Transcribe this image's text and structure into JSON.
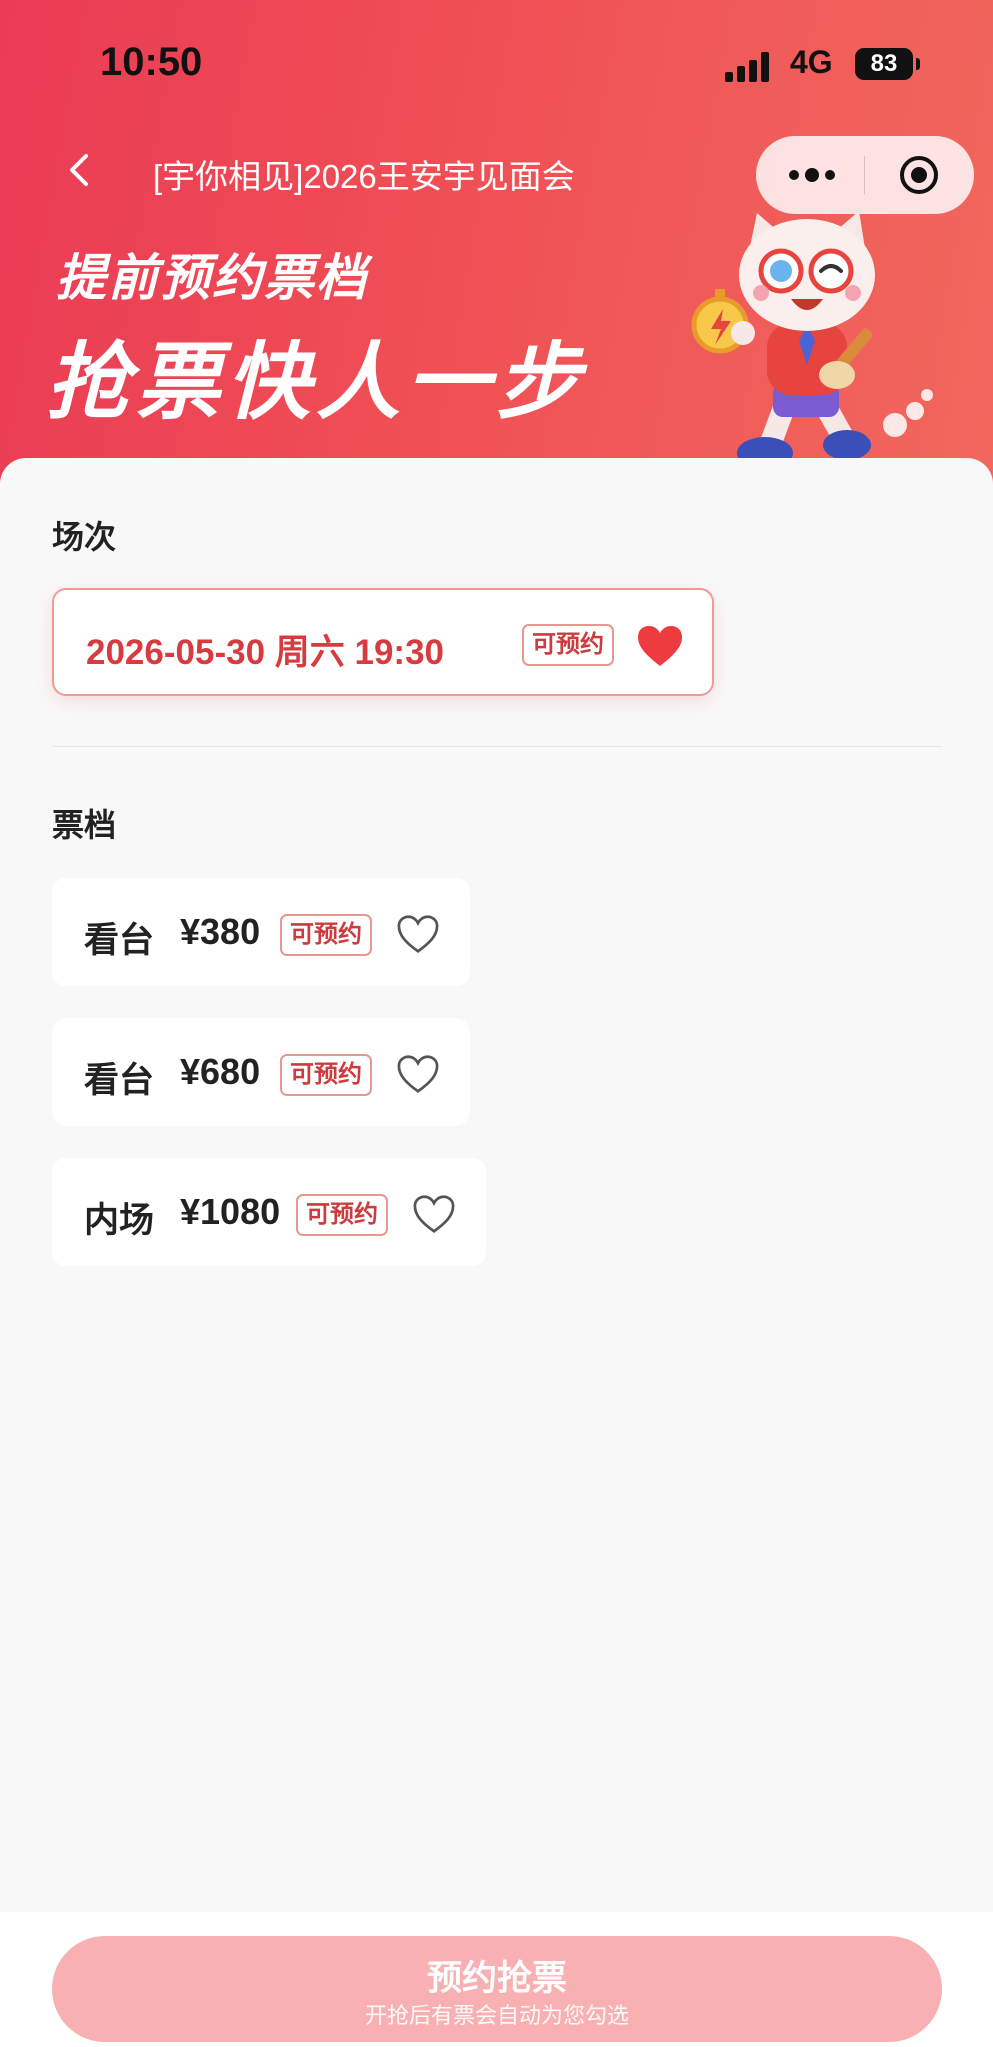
{
  "status_bar": {
    "time": "10:50",
    "network": "4G",
    "battery": "83"
  },
  "nav": {
    "title": "[宇你相见]2026王安宇见面会"
  },
  "banner": {
    "line1": "提前预约票档",
    "line2": "抢票快人一步"
  },
  "session": {
    "label": "场次",
    "items": [
      {
        "text": "2026-05-30 周六 19:30",
        "tag": "可预约",
        "favorited": true
      }
    ]
  },
  "tiers": {
    "label": "票档",
    "items": [
      {
        "area": "看台",
        "price": "¥380",
        "tag": "可预约",
        "favorited": false
      },
      {
        "area": "看台",
        "price": "¥680",
        "tag": "可预约",
        "favorited": false
      },
      {
        "area": "内场",
        "price": "¥1080",
        "tag": "可预约",
        "favorited": false
      }
    ]
  },
  "cta": {
    "label": "预约抢票",
    "sub": "开抢后有票会自动为您勾选"
  },
  "colors": {
    "brand": "#ea3b55",
    "accent": "#d83b3f",
    "cta_bg": "#f9b0b2"
  },
  "icons": [
    "signal-icon",
    "back-arrow-icon",
    "more-dots-icon",
    "target-icon",
    "heart-icon",
    "mascot-icon"
  ]
}
